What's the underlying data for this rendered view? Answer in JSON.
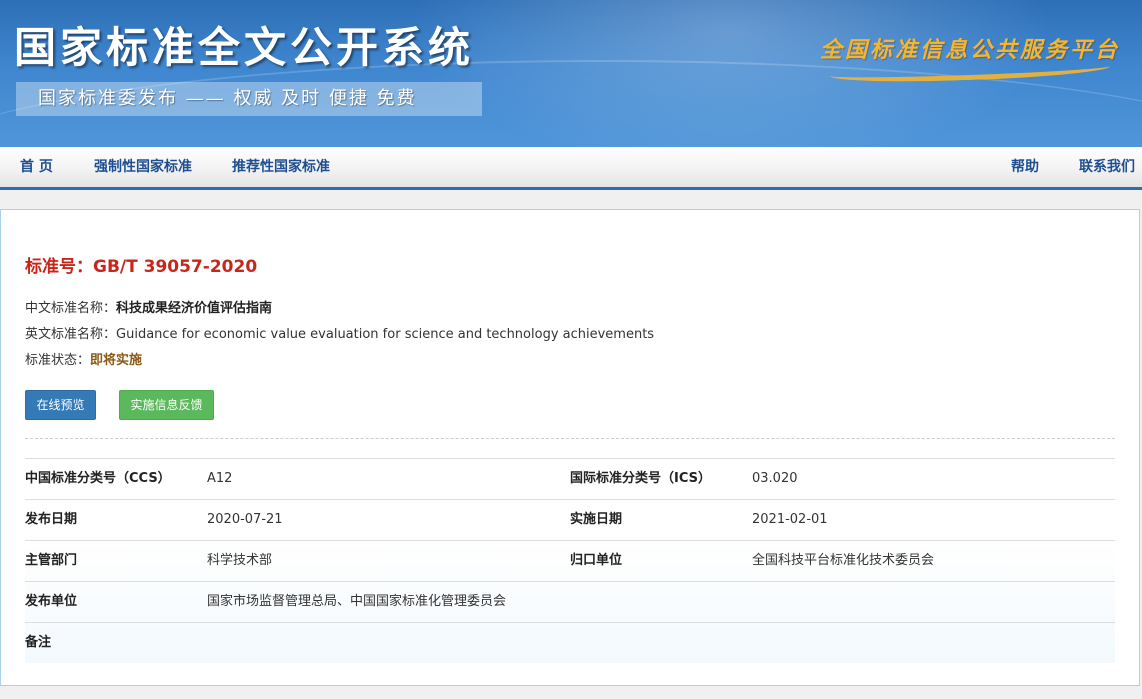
{
  "banner": {
    "title": "国家标准全文公开系统",
    "slogan": "国家标准委发布 —— 权威 及时 便捷 免费",
    "platform": "全国标准信息公共服务平台"
  },
  "nav": {
    "home": "首 页",
    "mandatory": "强制性国家标准",
    "recommended": "推荐性国家标准",
    "help": "帮助",
    "contact": "联系我们"
  },
  "standard": {
    "number_label": "标准号：",
    "number": "GB/T 39057-2020",
    "cn_name_label": "中文标准名称：",
    "cn_name": "科技成果经济价值评估指南",
    "en_name_label": "英文标准名称：",
    "en_name": "Guidance for economic value evaluation for science and technology achievements",
    "status_label": "标准状态：",
    "status": "即将实施"
  },
  "buttons": {
    "preview": "在线预览",
    "feedback": "实施信息反馈"
  },
  "details": [
    {
      "label1": "中国标准分类号（CCS）",
      "value1": "A12",
      "label2": "国际标准分类号（ICS）",
      "value2": "03.020"
    },
    {
      "label1": "发布日期",
      "value1": "2020-07-21",
      "label2": "实施日期",
      "value2": "2021-02-01"
    },
    {
      "label1": "主管部门",
      "value1": "科学技术部",
      "label2": "归口单位",
      "value2": "全国科技平台标准化技术委员会"
    },
    {
      "label1": "发布单位",
      "value1": "国家市场监督管理总局、中国国家标准化管理委员会",
      "label2": "",
      "value2": ""
    },
    {
      "label1": "备注",
      "value1": "",
      "label2": "",
      "value2": ""
    }
  ],
  "colors": {
    "banner_blue": "#3f86cf",
    "nav_text": "#1f4f91",
    "standard_number": "#c8261b",
    "status_text": "#8a5a16",
    "preview_button": "#337ab7",
    "feedback_button": "#5cb85c"
  }
}
